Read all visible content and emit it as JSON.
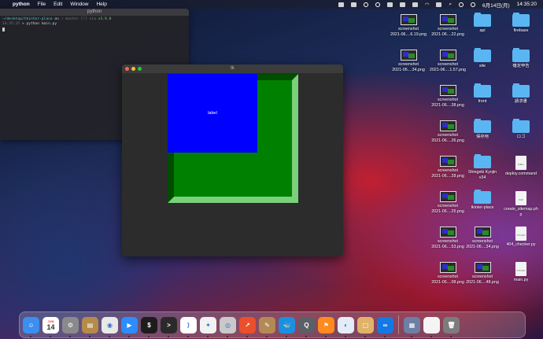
{
  "menubar": {
    "app_name": "python",
    "items": [
      "File",
      "Edit",
      "Window",
      "Help"
    ],
    "date": "6月14日(月)",
    "time": "14:35:20"
  },
  "terminal": {
    "title": "python",
    "line1_path": "~/desktop/tkinter-place",
    "line1_on": " on ",
    "line1_branch": "master [!] via",
    "line1_version": " v3.9.0",
    "line2_time": "14:35:15",
    "line2_cmd": " > python main.py"
  },
  "tk": {
    "title": "tk",
    "label_text": "label"
  },
  "desktop": {
    "col1": [
      {
        "type": "screenshot",
        "line1": "screenshot",
        "line2": "2021-06....6.19.png"
      },
      {
        "type": "screenshot",
        "line1": "screenshot",
        "line2": "2021-06....34.png"
      }
    ],
    "col2": [
      {
        "type": "screenshot",
        "line1": "screenshot",
        "line2": "2021-06....22.png"
      },
      {
        "type": "screenshot",
        "line1": "screenshot",
        "line2": "2021-06....1.57.png"
      },
      {
        "type": "screenshot",
        "line1": "screenshot",
        "line2": "2021-06....38.png"
      },
      {
        "type": "screenshot",
        "line1": "screenshot",
        "line2": "2021-06....26.png"
      },
      {
        "type": "screenshot",
        "line1": "screenshot",
        "line2": "2021-06....28.png"
      },
      {
        "type": "screenshot",
        "line1": "screenshot",
        "line2": "2021-06....25.png"
      },
      {
        "type": "screenshot",
        "line1": "screenshot",
        "line2": "2021-06....53.png"
      },
      {
        "type": "screenshot",
        "line1": "screenshot",
        "line2": "2021-06....08.png"
      }
    ],
    "col3": [
      {
        "type": "folder",
        "line1": "api",
        "line2": ""
      },
      {
        "type": "folder",
        "line1": "site",
        "line2": ""
      },
      {
        "type": "folder",
        "line1": "front",
        "line2": ""
      },
      {
        "type": "folder",
        "line1": "保存用",
        "line2": ""
      },
      {
        "type": "folder",
        "line1": "Shingeki Kyojin",
        "line2": "v34"
      },
      {
        "type": "folder",
        "line1": "tkinter-place",
        "line2": ""
      },
      {
        "type": "screenshot",
        "line1": "screenshot",
        "line2": "2021-06....34.png"
      },
      {
        "type": "screenshot",
        "line1": "screenshot",
        "line2": "2021-06....48.png"
      }
    ],
    "col4": [
      {
        "type": "folder",
        "line1": "firebase",
        "line2": ""
      },
      {
        "type": "folder",
        "line1": "確定申告",
        "line2": ""
      },
      {
        "type": "folder",
        "line1": "請求書",
        "line2": ""
      },
      {
        "type": "folder",
        "line1": "ロゴ",
        "line2": ""
      },
      {
        "type": "doc",
        "tag": "SHELL",
        "line1": "deploy.command",
        "line2": ""
      },
      {
        "type": "doc",
        "tag": "PHP",
        "line1": "create_sitemap.ph",
        "line2": "p"
      },
      {
        "type": "doc",
        "tag": "PYTHON",
        "line1": "404_checker.py",
        "line2": ""
      },
      {
        "type": "doc",
        "tag": "PYTHON",
        "line1": "main.py",
        "line2": ""
      }
    ]
  },
  "dock": {
    "calendar_month": "JUN",
    "calendar_day": "14",
    "apps": [
      {
        "name": "finder",
        "color": "#3c8ef0",
        "glyph": "☺"
      },
      {
        "name": "calendar",
        "color": "#ffffff",
        "glyph": ""
      },
      {
        "name": "system-preferences",
        "color": "#8a8a8a",
        "glyph": "⚙"
      },
      {
        "name": "archive-utility",
        "color": "#b58a4a",
        "glyph": "▤"
      },
      {
        "name": "chrome",
        "color": "#e8e8e8",
        "glyph": "◉"
      },
      {
        "name": "zoom",
        "color": "#2d8cff",
        "glyph": "▶"
      },
      {
        "name": "iterm",
        "color": "#1d1d1d",
        "glyph": "$"
      },
      {
        "name": "terminal",
        "color": "#2a2a2a",
        "glyph": ">"
      },
      {
        "name": "vscode",
        "color": "#ffffff",
        "glyph": "⟩"
      },
      {
        "name": "safari",
        "color": "#f2f2f2",
        "glyph": "✦"
      },
      {
        "name": "sequel-pro",
        "color": "#c9c9c9",
        "glyph": "◎"
      },
      {
        "name": "activity-monitor",
        "color": "#e9502b",
        "glyph": "↗"
      },
      {
        "name": "text-editor",
        "color": "#b38a55",
        "glyph": "✎"
      },
      {
        "name": "docker",
        "color": "#1d8fe1",
        "glyph": "🐳"
      },
      {
        "name": "quicktime",
        "color": "#5b5f66",
        "glyph": "Q"
      },
      {
        "name": "sourcetree",
        "color": "#ff8a1e",
        "glyph": "⚑"
      },
      {
        "name": "mysql-workbench",
        "color": "#e4edf6",
        "glyph": "◐"
      },
      {
        "name": "preview",
        "color": "#e1b36a",
        "glyph": "▢"
      },
      {
        "name": "infinity",
        "color": "#1478e6",
        "glyph": "∞"
      }
    ],
    "right_items": [
      {
        "name": "downloads-stack",
        "color": "#6d7fa3",
        "glyph": "▦"
      },
      {
        "name": "document-stack",
        "color": "#f4f4f4",
        "glyph": ""
      },
      {
        "name": "trash",
        "color": "#7c7c7c",
        "glyph": "🗑"
      }
    ]
  }
}
